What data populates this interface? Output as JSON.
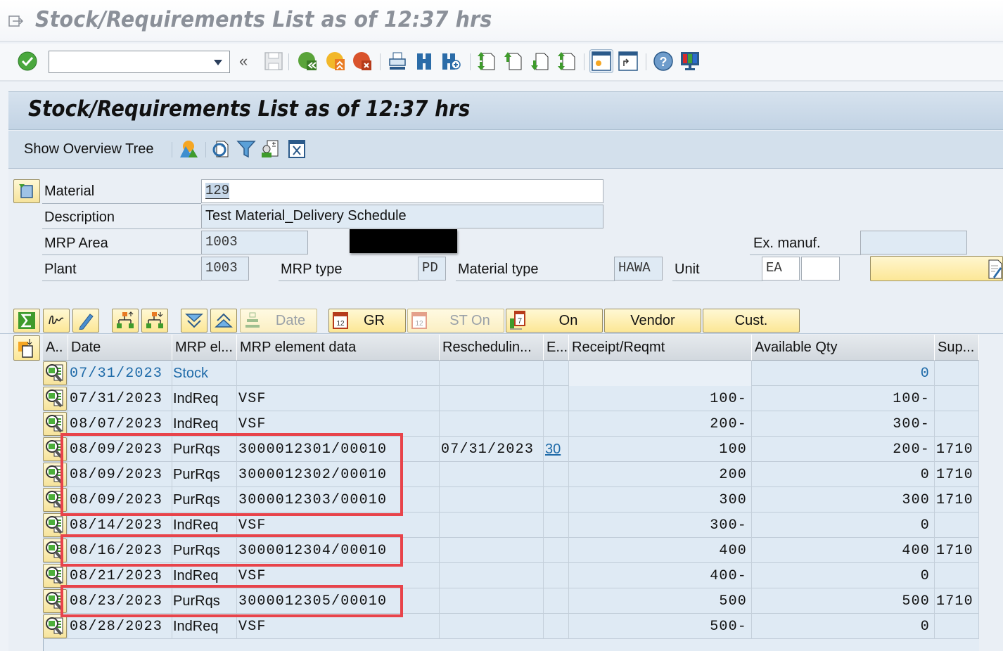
{
  "window": {
    "title": "Stock/Requirements List as of 12:37 hrs"
  },
  "toolbar": {
    "command_field_value": "",
    "icons": [
      "enter-check-icon",
      "command-dropdown-icon",
      "collapse-chevron-icon",
      "save-icon",
      "back-icon",
      "exit-icon",
      "cancel-icon",
      "print-icon",
      "find-icon",
      "find-next-icon",
      "first-page-icon",
      "previous-page-icon",
      "next-page-icon",
      "last-page-icon",
      "new-session-icon",
      "shortcut-icon",
      "help-icon",
      "customize-layout-icon"
    ]
  },
  "screen": {
    "title": "Stock/Requirements List as of 12:37 hrs",
    "appbar": {
      "show_overview_tree": "Show Overview Tree",
      "icons": [
        "planning-scenario-icon",
        "refresh-icon",
        "filter-icon",
        "user-settings-icon",
        "hide-icon"
      ]
    }
  },
  "header_fields": {
    "material_label": "Material",
    "material_value": "129",
    "description_label": "Description",
    "description_value": "Test Material_Delivery Schedule",
    "mrp_area_label": "MRP Area",
    "mrp_area_value": "1003",
    "plant_label": "Plant",
    "plant_value": "1003",
    "mrp_type_label": "MRP type",
    "mrp_type_value": "PD",
    "material_type_label": "Material type",
    "material_type_value": "HAWA",
    "unit_label": "Unit",
    "unit_value": "EA",
    "unit_value2": "",
    "ex_manuf_label": "Ex. manuf.",
    "ex_manuf_value": ""
  },
  "grid_toolbar": {
    "date_label": "Date",
    "gr_label": "GR",
    "st_on_label": "ST On",
    "on_label": "On",
    "vendor_label": "Vendor",
    "cust_label": "Cust."
  },
  "columns": {
    "a": "A..",
    "date": "Date",
    "mrp_element": "MRP el...",
    "mrp_element_data": "MRP element data",
    "rescheduling": "Reschedulin...",
    "e": "E...",
    "receipt_reqmt": "Receipt/Reqmt",
    "available_qty": "Available Qty",
    "sup": "Sup..."
  },
  "rows": [
    {
      "date": "07/31/2023",
      "mrp_element": "Stock",
      "mrp_element_data": "",
      "rescheduling": "",
      "e": "",
      "receipt_reqmt": "",
      "available_qty": "0",
      "sup": "",
      "highlight": false
    },
    {
      "date": "07/31/2023",
      "mrp_element": "IndReq",
      "mrp_element_data": "VSF",
      "rescheduling": "",
      "e": "",
      "receipt_reqmt": "100-",
      "available_qty": "100-",
      "sup": "",
      "highlight": false
    },
    {
      "date": "08/07/2023",
      "mrp_element": "IndReq",
      "mrp_element_data": "VSF",
      "rescheduling": "",
      "e": "",
      "receipt_reqmt": "200-",
      "available_qty": "300-",
      "sup": "",
      "highlight": false
    },
    {
      "date": "08/09/2023",
      "mrp_element": "PurRqs",
      "mrp_element_data": "3000012301/00010",
      "rescheduling": "07/31/2023",
      "e": "30",
      "receipt_reqmt": "100",
      "available_qty": "200-",
      "sup": "1710",
      "highlight": true
    },
    {
      "date": "08/09/2023",
      "mrp_element": "PurRqs",
      "mrp_element_data": "3000012302/00010",
      "rescheduling": "",
      "e": "",
      "receipt_reqmt": "200",
      "available_qty": "0",
      "sup": "1710",
      "highlight": true
    },
    {
      "date": "08/09/2023",
      "mrp_element": "PurRqs",
      "mrp_element_data": "3000012303/00010",
      "rescheduling": "",
      "e": "",
      "receipt_reqmt": "300",
      "available_qty": "300",
      "sup": "1710",
      "highlight": true
    },
    {
      "date": "08/14/2023",
      "mrp_element": "IndReq",
      "mrp_element_data": "VSF",
      "rescheduling": "",
      "e": "",
      "receipt_reqmt": "300-",
      "available_qty": "0",
      "sup": "",
      "highlight": false
    },
    {
      "date": "08/16/2023",
      "mrp_element": "PurRqs",
      "mrp_element_data": "3000012304/00010",
      "rescheduling": "",
      "e": "",
      "receipt_reqmt": "400",
      "available_qty": "400",
      "sup": "1710",
      "highlight": true
    },
    {
      "date": "08/21/2023",
      "mrp_element": "IndReq",
      "mrp_element_data": "VSF",
      "rescheduling": "",
      "e": "",
      "receipt_reqmt": "400-",
      "available_qty": "0",
      "sup": "",
      "highlight": false
    },
    {
      "date": "08/23/2023",
      "mrp_element": "PurRqs",
      "mrp_element_data": "3000012305/00010",
      "rescheduling": "",
      "e": "",
      "receipt_reqmt": "500",
      "available_qty": "500",
      "sup": "1710",
      "highlight": true
    },
    {
      "date": "08/28/2023",
      "mrp_element": "IndReq",
      "mrp_element_data": "VSF",
      "rescheduling": "",
      "e": "",
      "receipt_reqmt": "500-",
      "available_qty": "0",
      "sup": "",
      "highlight": false
    }
  ],
  "colors": {
    "highlight_box": "#e8434a",
    "link_blue": "#1e6aa8",
    "row_bg": "#dfeaf4",
    "button_yellow": "#fce796"
  }
}
